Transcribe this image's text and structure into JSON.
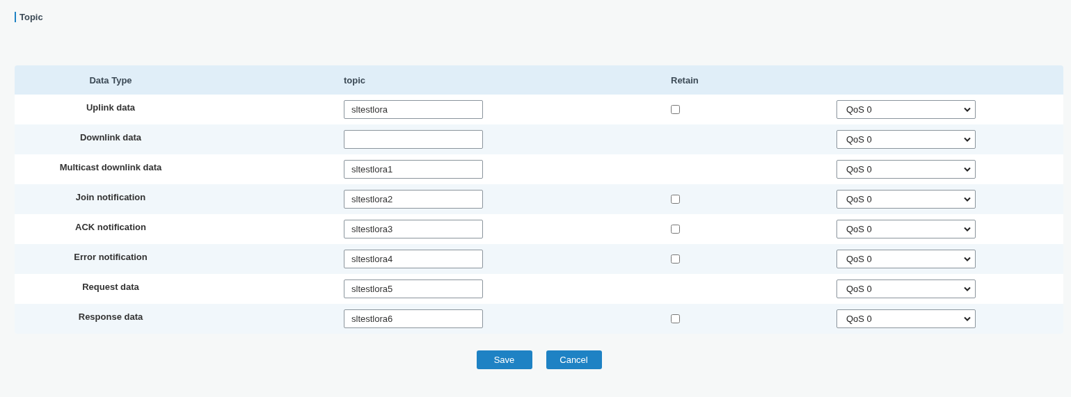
{
  "section_title": "Topic",
  "table": {
    "columns": [
      "Data Type",
      "topic",
      "Retain"
    ],
    "rows": [
      {
        "data_type": "Uplink data",
        "topic": "sltestlora",
        "retain": {
          "checked": false
        },
        "qos": "QoS 0"
      },
      {
        "data_type": "Downlink data",
        "topic": "",
        "qos": "QoS 0"
      },
      {
        "data_type": "Multicast downlink data",
        "topic": "sltestlora1",
        "qos": "QoS 0"
      },
      {
        "data_type": "Join notification",
        "topic": "sltestlora2",
        "retain": {
          "checked": false
        },
        "qos": "QoS 0"
      },
      {
        "data_type": "ACK notification",
        "topic": "sltestlora3",
        "retain": {
          "checked": false
        },
        "qos": "QoS 0"
      },
      {
        "data_type": "Error notification",
        "topic": "sltestlora4",
        "retain": {
          "checked": false
        },
        "qos": "QoS 0"
      },
      {
        "data_type": "Request data",
        "topic": "sltestlora5",
        "qos": "QoS 0"
      },
      {
        "data_type": "Response data",
        "topic": "sltestlora6",
        "retain": {
          "checked": false
        },
        "qos": "QoS 0"
      }
    ]
  },
  "buttons": [
    "Save",
    "Cancel"
  ]
}
